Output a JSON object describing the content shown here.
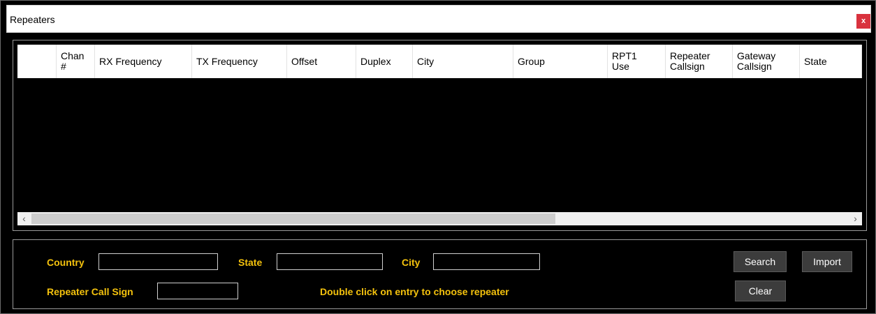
{
  "window": {
    "title": "Repeaters",
    "close_label": "x"
  },
  "grid": {
    "columns": [
      {
        "label": ""
      },
      {
        "label": "Chan\n#"
      },
      {
        "label": "RX Frequency"
      },
      {
        "label": "TX Frequency"
      },
      {
        "label": "Offset"
      },
      {
        "label": "Duplex"
      },
      {
        "label": "City"
      },
      {
        "label": "Group"
      },
      {
        "label": "RPT1\nUse"
      },
      {
        "label": "Repeater\nCallsign"
      },
      {
        "label": "Gateway\nCallsign"
      },
      {
        "label": "State"
      }
    ],
    "rows": [],
    "scroll_left_icon": "‹",
    "scroll_right_icon": "›"
  },
  "search": {
    "country_label": "Country",
    "country_value": "",
    "state_label": "State",
    "state_value": "",
    "city_label": "City",
    "city_value": "",
    "callsign_label": "Repeater Call Sign",
    "callsign_value": "",
    "hint": "Double click on entry to choose repeater",
    "search_button": "Search",
    "import_button": "Import",
    "clear_button": "Clear"
  },
  "colors": {
    "accent_label": "#f4c20d",
    "close_button": "#d9323e",
    "background": "#000000"
  }
}
